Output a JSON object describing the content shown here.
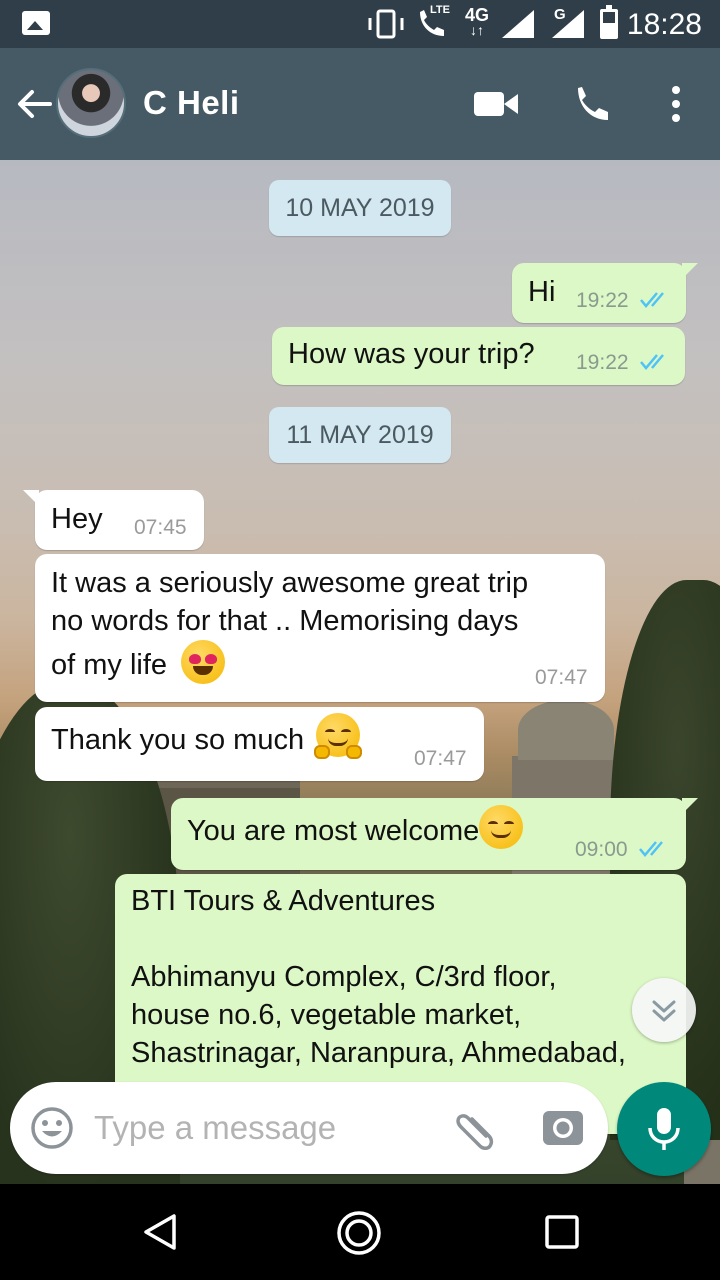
{
  "status_bar": {
    "time": "18:28",
    "network_4g": "4G",
    "lte": "LTE",
    "g": "G"
  },
  "header": {
    "contact_name": "C Heli",
    "icons": [
      "back-arrow-icon",
      "video-call-icon",
      "phone-icon",
      "more-vert-icon"
    ]
  },
  "chat": {
    "date_1": "10 MAY 2019",
    "date_2": "11 MAY 2019",
    "messages": [
      {
        "dir": "out",
        "text": "Hi",
        "time": "19:22",
        "status": "read"
      },
      {
        "dir": "out",
        "text": "How was your trip?",
        "time": "19:22",
        "status": "read"
      },
      {
        "dir": "in",
        "text": "Hey",
        "time": "07:45"
      },
      {
        "dir": "in",
        "text_line1": "It was a seriously awesome great trip",
        "text_line2": "no words for that .. Memorising days",
        "text_line3": "of my life",
        "emoji": "heart-eyes-emoji",
        "time": "07:47"
      },
      {
        "dir": "in",
        "text": "Thank you so much",
        "emoji": "hugging-emoji",
        "time": "07:47"
      },
      {
        "dir": "out",
        "text": "You are most welcome",
        "emoji": "smiling-emoji",
        "time": "09:00",
        "status": "read"
      },
      {
        "dir": "out",
        "line1": "BTI Tours & Adventures",
        "line2": "Abhimanyu Complex, C/3rd floor,",
        "line3": "house no.6, vegetable market,",
        "line4": "Shastrinagar, Naranpura, Ahmedabad,"
      }
    ]
  },
  "composer": {
    "placeholder": "Type a message"
  },
  "colors": {
    "header": "#455a64",
    "statusbar": "#2f3e48",
    "bubble_out": "#dcf8c6",
    "bubble_in": "#ffffff",
    "date_chip": "#d4e8f2",
    "read_ticks": "#4fc3f7",
    "mic_button": "#00897b"
  }
}
